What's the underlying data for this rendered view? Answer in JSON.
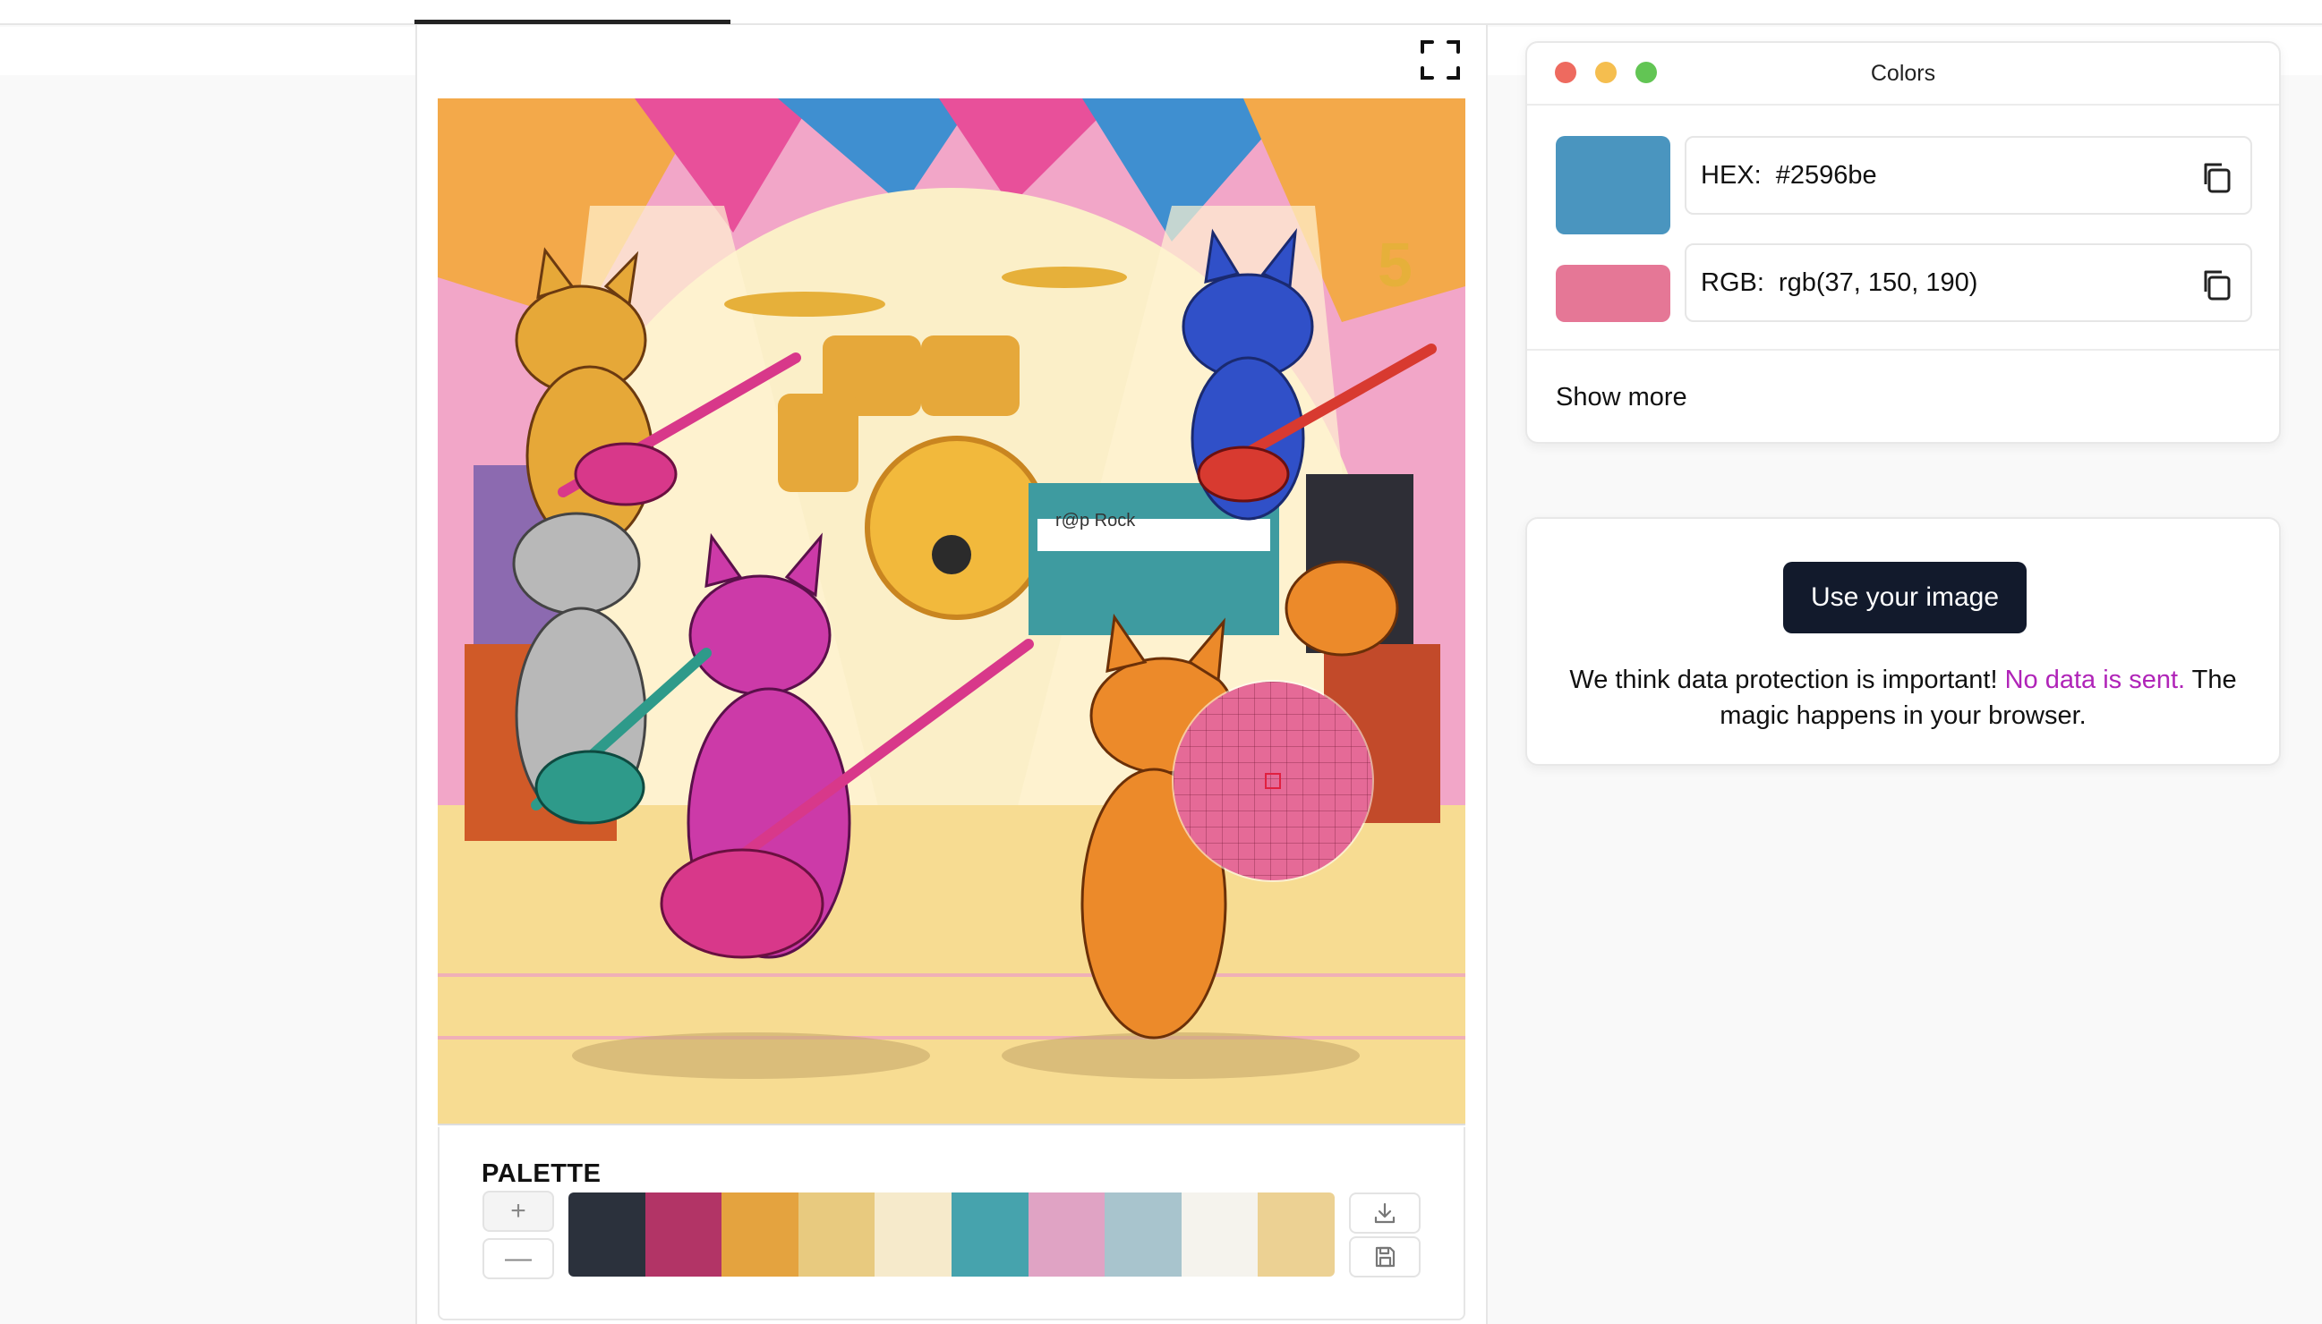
{
  "colors_panel": {
    "title": "Colors",
    "hex_label": "HEX:",
    "hex_value": "#2596be",
    "rgb_label": "RGB:",
    "rgb_value": "rgb(37, 150, 190)",
    "show_more": "Show more",
    "primary_swatch": "#4a95bf",
    "secondary_swatch": "#e57796"
  },
  "upload": {
    "button_label": "Use your image",
    "privacy_before": "We think data protection is important!",
    "privacy_accent": "No data is sent.",
    "privacy_after": "The magic happens in your browser."
  },
  "palette": {
    "title": "PALETTE",
    "add_symbol": "+",
    "remove_symbol": "—",
    "swatches": [
      "#2b313c",
      "#b23466",
      "#e4a33f",
      "#e8ca7f",
      "#f6eacb",
      "#46a3ad",
      "#e0a3c4",
      "#a8c4cd",
      "#f5f3ed",
      "#ecd193"
    ]
  },
  "magnifier": {
    "sample_color": "#e56a97"
  },
  "icons": {
    "fullscreen": "fullscreen-icon",
    "copy": "copy-icon",
    "download": "download-icon",
    "save": "save-icon"
  }
}
